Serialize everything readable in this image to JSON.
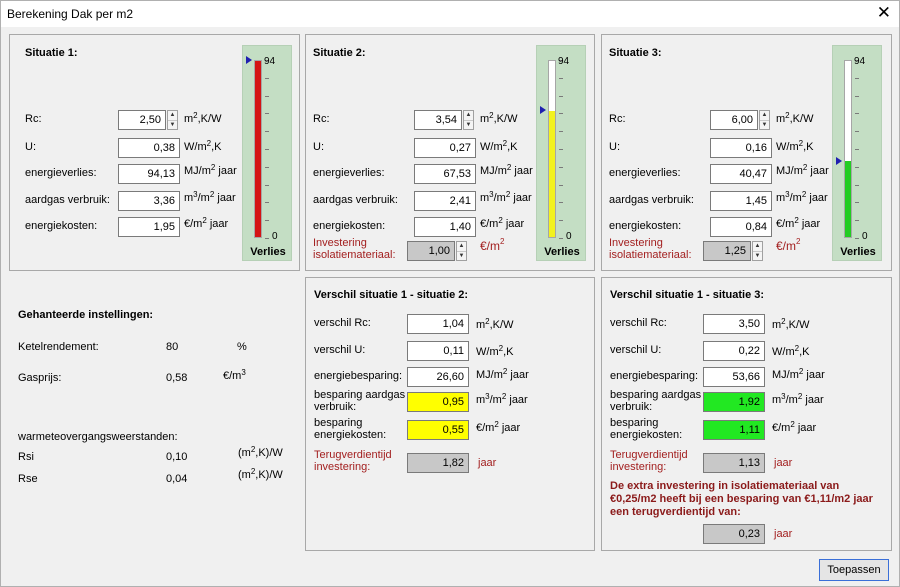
{
  "window": {
    "title": "Berekening Dak per m2"
  },
  "units": {
    "m2kw": "m²,K/W",
    "wm2k": "W/m²,K",
    "mjm2": "MJ/m² jaar",
    "m3m2": "m³/m² jaar",
    "eurm2j": "€/m² jaar",
    "eurm2": "€/m²",
    "jaar": "jaar",
    "pct": "%",
    "eurm3": "€/m³",
    "m2kw2": "(m²,K)/W"
  },
  "labels": {
    "rc": "Rc:",
    "u": "U:",
    "energieverlies": "energieverlies:",
    "aardgas": "aardgas verbruik:",
    "energiekosten": "energiekosten:",
    "investering1": "Investering",
    "investering2": "isolatiemateriaal:",
    "verschil_rc": "verschil Rc:",
    "verschil_u": "verschil U:",
    "energiebesparing": "energiebesparing:",
    "besparing_aardgas1": "besparing aardgas",
    "besparing_aardgas2": "verbruik:",
    "besparing_kosten1": "besparing",
    "besparing_kosten2": "energiekosten:",
    "terugverdien1": "Terugverdientijd",
    "terugverdien2": "investering:"
  },
  "gauge": {
    "max_label": "94",
    "min_label": "0",
    "label": "Verlies",
    "max": 94,
    "min": 0
  },
  "situaties": [
    {
      "title": "Situatie 1:",
      "rc": "2,50",
      "u": "0,38",
      "energieverlies": "94,13",
      "aardgas": "3,36",
      "energiekosten": "1,95",
      "investering": null,
      "level": 94.13,
      "fill_color": "#d41414"
    },
    {
      "title": "Situatie 2:",
      "rc": "3,54",
      "u": "0,27",
      "energieverlies": "67,53",
      "aardgas": "2,41",
      "energiekosten": "1,40",
      "investering": "1,00",
      "level": 67.53,
      "fill_color": "#f2f21e"
    },
    {
      "title": "Situatie 3:",
      "rc": "6,00",
      "u": "0,16",
      "energieverlies": "40,47",
      "aardgas": "1,45",
      "energiekosten": "0,84",
      "investering": "1,25",
      "level": 40.47,
      "fill_color": "#22cc22"
    }
  ],
  "verschil": [
    {
      "title": "Verschil situatie 1 - situatie 2:",
      "rc": "1,04",
      "u": "0,11",
      "energiebesparing": "26,60",
      "besparing_aardgas": "0,95",
      "besparing_kosten": "0,55",
      "terugverdien": "1,82",
      "highlight": "#ffff00"
    },
    {
      "title": "Verschil situatie 1 - situatie 3:",
      "rc": "3,50",
      "u": "0,22",
      "energiebesparing": "53,66",
      "besparing_aardgas": "1,92",
      "besparing_kosten": "1,11",
      "terugverdien": "1,13",
      "highlight": "#22e822"
    }
  ],
  "extra": {
    "message": "De extra investering in isolatiemateriaal van €0,25/m2 heeft bij een besparing van €1,11/m2 jaar een terugverdientijd van:",
    "value": "0,23"
  },
  "instellingen": {
    "title": "Gehanteerde instellingen:",
    "ketel_label": "Ketelrendement:",
    "ketel_value": "80",
    "gas_label": "Gasprijs:",
    "gas_value": "0,58",
    "warmte_title": "warmeteovergangsweerstanden:",
    "rsi_label": "Rsi",
    "rsi_value": "0,10",
    "rse_label": "Rse",
    "rse_value": "0,04"
  },
  "buttons": {
    "apply": "Toepassen"
  },
  "colors": {
    "readonly": "#c8c8c8",
    "accent_red": "#a32020",
    "button_border": "#3a6fd8"
  }
}
